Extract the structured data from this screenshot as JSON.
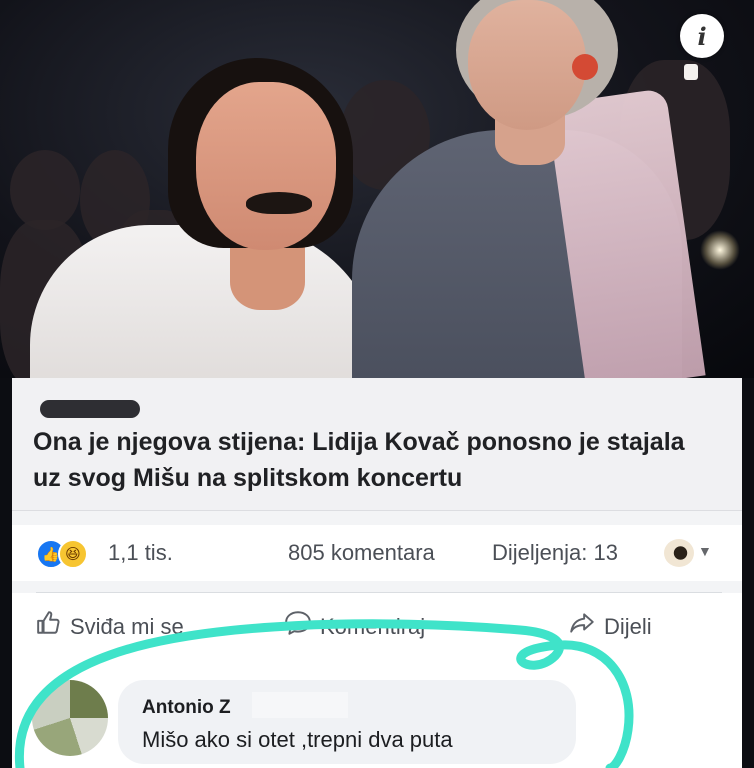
{
  "photo": {
    "info_icon": "info-icon",
    "info_glyph": "i"
  },
  "post": {
    "headline": "Ona je njegova stijena: Lidija Kovač ponosno je stajala uz svog Mišu na splitskom koncertu"
  },
  "stats": {
    "reactions": [
      "like",
      "haha"
    ],
    "reaction_count": "1,1 tis.",
    "comments": "805 komentara",
    "shares": "Dijeljenja: 13"
  },
  "actions": {
    "like_label": "Sviđa mi se",
    "comment_label": "Komentiraj",
    "share_label": "Dijeli"
  },
  "comment": {
    "author": "Antonio Z",
    "text": "Mišo ako si otet ,trepni dva puta"
  },
  "colors": {
    "scribble": "#3fe3c9",
    "like_blue": "#1877f2",
    "haha_yellow": "#f7c531"
  }
}
